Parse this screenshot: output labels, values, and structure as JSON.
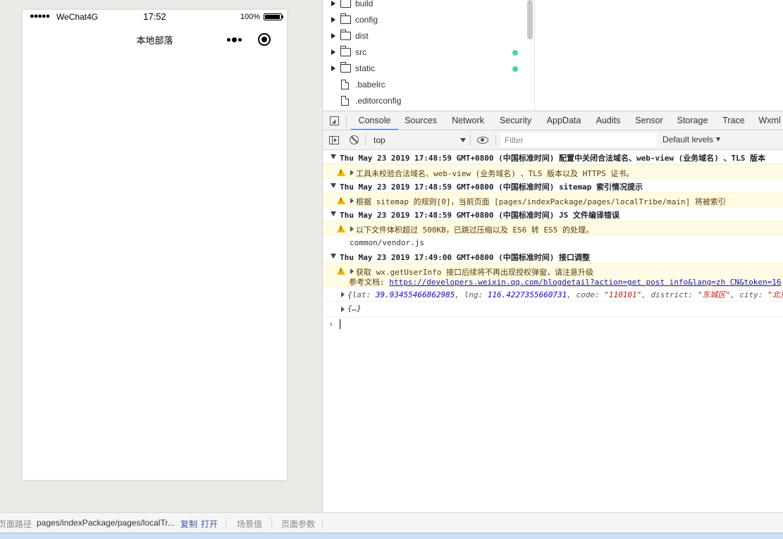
{
  "simulator": {
    "status_bar": {
      "signal": "●●●●●",
      "carrier": "WeChat4G",
      "time": "17:52",
      "battery": "100%"
    },
    "nav_title": "本地部落"
  },
  "file_tree": [
    {
      "label": "build",
      "type": "folder",
      "dot": false
    },
    {
      "label": "config",
      "type": "folder",
      "dot": false
    },
    {
      "label": "dist",
      "type": "folder",
      "dot": false
    },
    {
      "label": "src",
      "type": "folder",
      "dot": true
    },
    {
      "label": "static",
      "type": "folder",
      "dot": true
    },
    {
      "label": ".babelrc",
      "type": "file",
      "dot": false
    },
    {
      "label": ".editorconfig",
      "type": "file",
      "dot": false
    }
  ],
  "devtools": {
    "tabs": [
      "Console",
      "Sources",
      "Network",
      "Security",
      "AppData",
      "Audits",
      "Sensor",
      "Storage",
      "Trace",
      "Wxml"
    ],
    "active_tab": "Console"
  },
  "console_toolbar": {
    "context": "top",
    "filter_placeholder": "Filter",
    "levels": "Default levels"
  },
  "console": {
    "group1_header": "Thu May 23 2019 17:48:59 GMT+0800 (中国标准时间) 配置中关闭合法域名、web-view (业务域名) 、TLS 版本",
    "group1_warn": "工具未校验合法域名、web-view (业务域名) 、TLS 版本以及 HTTPS 证书。",
    "group2_header": "Thu May 23 2019 17:48:59 GMT+0800 (中国标准时间) sitemap 索引情况提示",
    "group2_warn": " 根据 sitemap 的规则[0]，当前页面 [pages/indexPackage/pages/localTribe/main] 将被索引",
    "group3_header": "Thu May 23 2019 17:48:59 GMT+0800 (中国标准时间) JS 文件编译错误",
    "group3_warn": "以下文件体积超过 500KB，已跳过压缩以及 ES6 转 ES5 的处理。",
    "group3_file": "common/vendor.js",
    "group4_header": "Thu May 23 2019 17:49:00 GMT+0800 (中国标准时间) 接口调整",
    "group4_warn": "获取 wx.getUserInfo 接口后续将不再出现授权弹窗，请注意升级",
    "group4_doc_label": "参考文档: ",
    "group4_doc_link": "https://developers.weixin.qq.com/blogdetail?action=get_post_info&lang=zh_CN&token=16",
    "obj1": {
      "open": "{",
      "lat_key": "lat: ",
      "lat": "39.93455466862985",
      "lng_key": ", lng: ",
      "lng": "116.4227355660731",
      "code_key": ", code: ",
      "code": "\"110101\"",
      "district_key": ", district: ",
      "district": "\"东城区\"",
      "city_key": ", city: ",
      "city": "\"北京"
    },
    "obj2": "{…}",
    "prompt": "›"
  },
  "bottom_bar": {
    "path_label": "页面路径",
    "path": "pages/indexPackage/pages/localTr...",
    "copy": "复制",
    "open": "打开",
    "scene": "场景值",
    "params": "页面参数"
  }
}
